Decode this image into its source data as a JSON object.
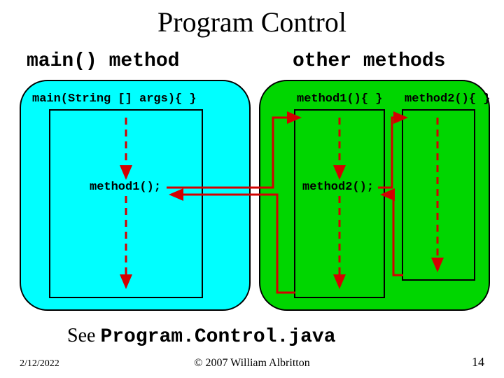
{
  "title": "Program Control",
  "labels": {
    "main_method": "main() method",
    "other_methods": "other methods"
  },
  "signatures": {
    "main": "main(String [] args){ }",
    "method1": "method1(){ }",
    "method2": "method2(){ }"
  },
  "calls": {
    "method1": "method1();",
    "method2": "method2();"
  },
  "see": {
    "prefix": "See ",
    "filename": "Program.Control.java"
  },
  "footer": {
    "date": "2/12/2022",
    "copyright": "© 2007 William Albritton",
    "page": "14"
  },
  "colors": {
    "cyan": "#00ffff",
    "green": "#00d600",
    "arrow": "#d40000"
  }
}
